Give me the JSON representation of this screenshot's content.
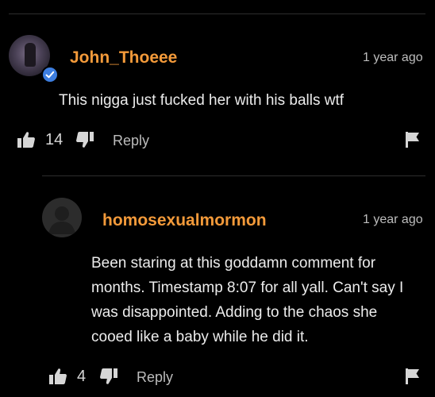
{
  "colors": {
    "background": "#000000",
    "username": "#f39a3a",
    "text": "#ececec",
    "meta": "#bdbdbd",
    "verified_badge": "#3d7ee0"
  },
  "comments": [
    {
      "username": "John_Thoeee",
      "verified": true,
      "time": "1 year ago",
      "text": "This nigga just fucked her with his balls wtf",
      "likes": "14",
      "reply_label": "Reply",
      "icons": [
        "thumbs-up-icon",
        "thumbs-down-icon",
        "flag-icon",
        "checkmark-icon"
      ]
    },
    {
      "username": "homosexualmormon",
      "verified": false,
      "time": "1 year ago",
      "text": "Been staring at this goddamn comment for months. Timestamp 8:07 for all yall. Can't say I was disappointed. Adding to the chaos she cooed like a baby while he did it.",
      "likes": "4",
      "reply_label": "Reply",
      "icons": [
        "default-avatar-icon",
        "thumbs-up-icon",
        "thumbs-down-icon",
        "flag-icon"
      ]
    }
  ]
}
